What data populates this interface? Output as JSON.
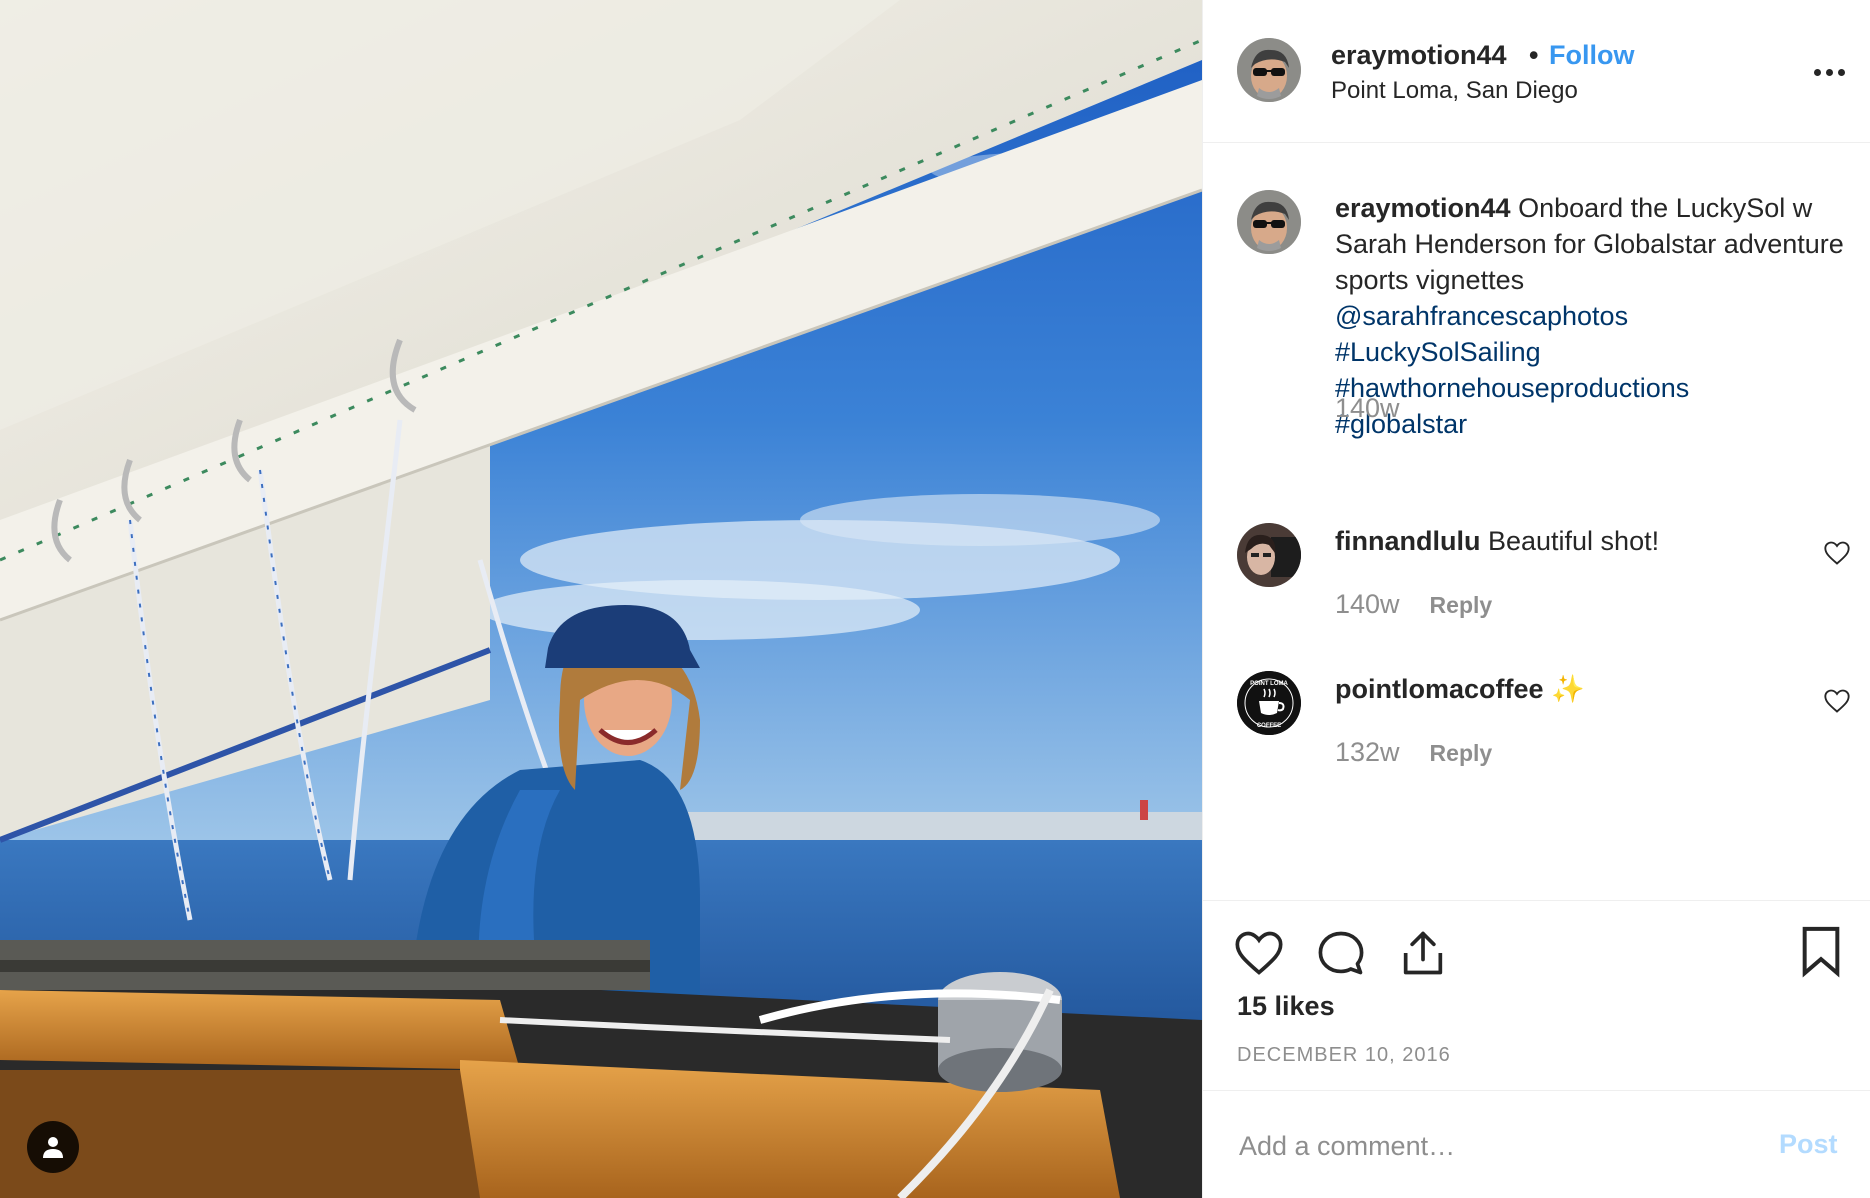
{
  "post": {
    "username": "eraymotion44",
    "separator": "•",
    "follow_label": "Follow",
    "location": "Point Loma, San Diego"
  },
  "caption": {
    "username": "eraymotion44",
    "text": "Onboard the LuckySol w Sarah Henderson for Globalstar adventure sports vignettes",
    "links": [
      "@sarahfrancescaphotos",
      "#LuckySolSailing",
      "#hawthornehouseproductions",
      "#globalstar"
    ],
    "time": "140w"
  },
  "comments": [
    {
      "username": "finnandlulu",
      "text": "Beautiful shot!",
      "time": "140w",
      "reply_label": "Reply"
    },
    {
      "username": "pointlomacoffee",
      "text": "✨",
      "time": "132w",
      "reply_label": "Reply"
    }
  ],
  "stats": {
    "likes": "15 likes",
    "date": "DECEMBER 10, 2016"
  },
  "add_comment": {
    "placeholder": "Add a comment…",
    "post_label": "Post"
  },
  "icons": {
    "more": "more-options-icon",
    "like": "heart-icon",
    "comment": "comment-icon",
    "share": "share-icon",
    "save": "bookmark-icon",
    "user_tag": "user-icon",
    "comment_like": "heart-icon"
  },
  "colors": {
    "link": "#003569",
    "follow": "#3897f0",
    "muted": "#8e8e8e",
    "text": "#262626",
    "post_disabled": "#b3dbff"
  },
  "badge_logo_text": "POINT LOMA COFFEE"
}
